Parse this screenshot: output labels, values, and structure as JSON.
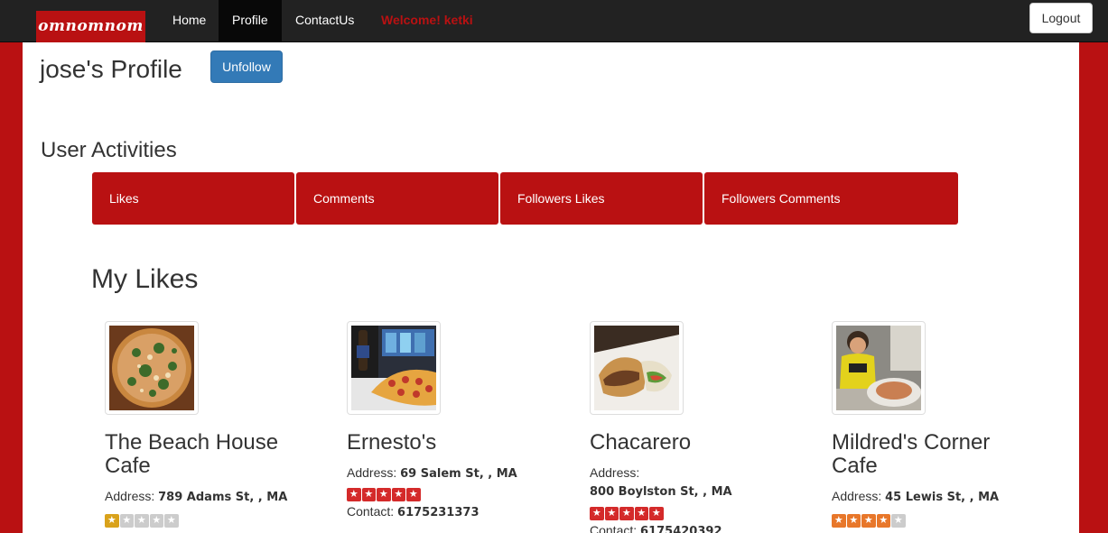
{
  "nav": {
    "brand": "omnomnom",
    "links": [
      {
        "label": "Home",
        "active": false
      },
      {
        "label": "Profile",
        "active": true
      },
      {
        "label": "ContactUs",
        "active": false
      }
    ],
    "welcome": "Welcome! ketki",
    "logout": "Logout"
  },
  "profile": {
    "title": "jose's Profile",
    "unfollow": "Unfollow"
  },
  "activities": {
    "title": "User Activities",
    "tabs": [
      {
        "label": "Likes"
      },
      {
        "label": "Comments"
      },
      {
        "label": "Followers Likes"
      },
      {
        "label": "Followers Comments"
      }
    ]
  },
  "likes": {
    "title": "My Likes",
    "address_label": "Address:",
    "contact_label": "Contact:",
    "items": [
      {
        "name": "The Beach House Cafe",
        "address": "789 Adams St, , MA",
        "rating": 1,
        "max_rating": 5,
        "star_color": "#d9a21b",
        "contact": "",
        "image": "pizza-photo"
      },
      {
        "name": "Ernesto's",
        "address": "69 Salem St, , MA",
        "rating": 5,
        "max_rating": 5,
        "star_color": "#d42a2a",
        "contact": "6175231373",
        "image": "pizza-slice-photo"
      },
      {
        "name": "Chacarero",
        "address": "800 Boylston St, , MA",
        "rating": 5,
        "max_rating": 5,
        "star_color": "#d42a2a",
        "contact": "6175420392",
        "image": "sandwich-photo"
      },
      {
        "name": "Mildred's Corner Cafe",
        "address": "45 Lewis St, , MA",
        "rating": 4,
        "max_rating": 5,
        "star_color": "#e8772a",
        "contact": "",
        "image": "child-photo"
      }
    ]
  },
  "colors": {
    "brand_red": "#b91112",
    "navbar": "#222222",
    "button_blue": "#337ab7",
    "star_empty": "#cccccc"
  }
}
